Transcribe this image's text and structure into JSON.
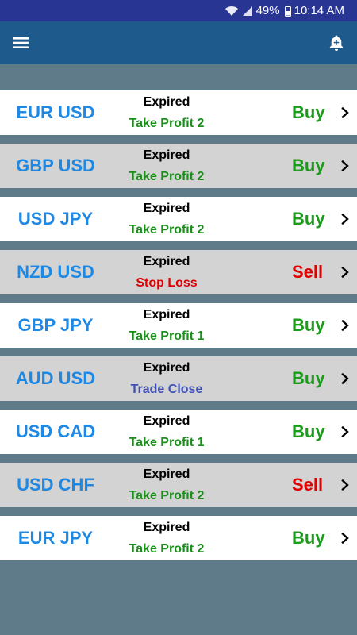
{
  "status_bar": {
    "battery": "49%",
    "time": "10:14 AM"
  },
  "app_bar": {
    "menu_icon": "hamburger-menu-icon",
    "right_icon": "notification-bell-add-icon"
  },
  "colors": {
    "status_bar_bg": "#283592",
    "app_bar_bg": "#1f5a8c",
    "background": "#5f7b89",
    "pair_text": "#1e88e5",
    "buy": "#1a9b1a",
    "sell": "#e00000",
    "take_profit": "#1a8f1a",
    "stop_loss": "#e00000",
    "trade_close": "#3f51b5"
  },
  "signals": [
    {
      "pair": "EUR USD",
      "state": "Expired",
      "result": "Take Profit 2",
      "result_type": "take_profit",
      "action": "Buy",
      "action_type": "buy",
      "row_style": "white"
    },
    {
      "pair": "GBP USD",
      "state": "Expired",
      "result": "Take Profit 2",
      "result_type": "take_profit",
      "action": "Buy",
      "action_type": "buy",
      "row_style": "grey"
    },
    {
      "pair": "USD JPY",
      "state": "Expired",
      "result": "Take Profit 2",
      "result_type": "take_profit",
      "action": "Buy",
      "action_type": "buy",
      "row_style": "white"
    },
    {
      "pair": "NZD USD",
      "state": "Expired",
      "result": "Stop Loss",
      "result_type": "stop_loss",
      "action": "Sell",
      "action_type": "sell",
      "row_style": "grey"
    },
    {
      "pair": "GBP JPY",
      "state": "Expired",
      "result": "Take Profit 1",
      "result_type": "take_profit",
      "action": "Buy",
      "action_type": "buy",
      "row_style": "white"
    },
    {
      "pair": "AUD USD",
      "state": "Expired",
      "result": "Trade Close",
      "result_type": "trade_close",
      "action": "Buy",
      "action_type": "buy",
      "row_style": "grey"
    },
    {
      "pair": "USD CAD",
      "state": "Expired",
      "result": "Take Profit 1",
      "result_type": "take_profit",
      "action": "Buy",
      "action_type": "buy",
      "row_style": "white"
    },
    {
      "pair": "USD CHF",
      "state": "Expired",
      "result": "Take Profit 2",
      "result_type": "take_profit",
      "action": "Sell",
      "action_type": "sell",
      "row_style": "grey"
    },
    {
      "pair": "EUR JPY",
      "state": "Expired",
      "result": "Take Profit 2",
      "result_type": "take_profit",
      "action": "Buy",
      "action_type": "buy",
      "row_style": "white"
    }
  ]
}
